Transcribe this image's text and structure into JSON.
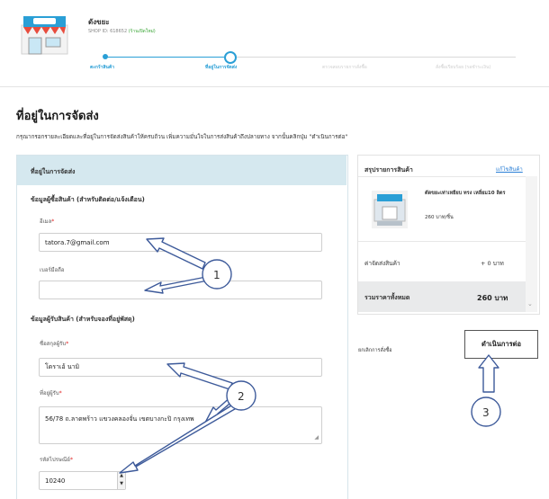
{
  "shop": {
    "name": "ดังขยะ",
    "id_text": "SHOP ID: 618652",
    "badge": "(ร้านเปิดใหม่)"
  },
  "steps": [
    {
      "label": "ตะกร้าสินค้า",
      "state": "done"
    },
    {
      "label": "ที่อยู่ในการจัดส่ง",
      "state": "current"
    },
    {
      "label": "ตรวจสอบรายการสั่งซื้อ",
      "state": "pending"
    },
    {
      "label": "สั่งซื้อเรียบร้อย (รอชำระเงิน)",
      "state": "pending"
    }
  ],
  "page": {
    "title": "ที่อยู่ในการจัดส่ง",
    "description": "กรุณากรอกรายละเอียดและที่อยู่ในการจัดส่งสินค้าให้ครบถ้วน เพิ่มความมั่นใจในการส่งสินค้าถึงปลายทาง จากนั้นคลิกปุ่ม \"ดำเนินการต่อ\""
  },
  "form": {
    "panel_title": "ที่อยู่ในการจัดส่ง",
    "buyer_section": "ข้อมูลผู้ซื้อสินค้า (สำหรับติดต่อ/แจ้งเตือน)",
    "email_label": "อีเมล",
    "email_value": "tatora.7@gmail.com",
    "phone_label": "เบอร์มือถือ",
    "phone_value": "",
    "receiver_section": "ข้อมูลผู้รับสินค้า (สำหรับจองที่อยู่พัสดุ)",
    "name_label": "ชื่อสกุลผู้รับ",
    "name_value": "โดราเอ้ นามิ",
    "address_label": "ที่อยู่ผู้รับ",
    "address_value": "56/78 ถ.ลาดพร้าว แขวงคลองจั่น เขตบางกะปิ กรุงเทพ",
    "zip_label": "รหัสไปรษณีย์",
    "zip_value": "10240",
    "required_mark": "*"
  },
  "summary": {
    "title": "สรุปรายการสินค้า",
    "edit_link": "แก้ไขสินค้า",
    "product_name": "ตัดขยะเท่าเหยียบ ทรง เหลี่ยม10 ลิตร",
    "product_price": "260 บาท/ชิ้น",
    "shipping_label": "ค่าจัดส่งสินค้า",
    "shipping_value": "+ 0 บาท",
    "total_label": "รวมราคาทั้งหมด",
    "total_value": "260 บาท",
    "scroll_arrow": "⌄"
  },
  "actions": {
    "back_link": "ยกเลิกการสั่งซื้อ",
    "proceed_button": "ดำเนินการต่อ"
  },
  "annotations": [
    {
      "label": "1"
    },
    {
      "label": "2"
    },
    {
      "label": "3"
    }
  ],
  "colors": {
    "accent": "#2a9fd6",
    "panel_header": "#d5e8ef",
    "total_bar": "#e9eaeb",
    "required": "#e02020"
  },
  "icons": [
    "shop-logo-icon",
    "product-thumbnail-icon",
    "dropdown-arrow-icon",
    "resize-handle-icon"
  ]
}
